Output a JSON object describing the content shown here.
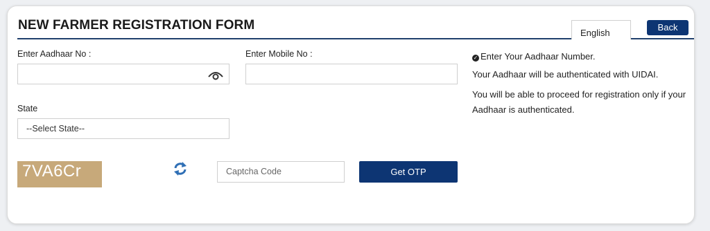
{
  "form": {
    "title": "NEW FARMER REGISTRATION FORM",
    "language": "English",
    "back_label": "Back",
    "aadhaar_label": "Enter Aadhaar No :",
    "aadhaar_value": "",
    "mobile_label": "Enter Mobile No :",
    "mobile_value": "",
    "state_label": "State",
    "state_selected": "--Select State--",
    "captcha_text": "7VA6Cr",
    "captcha_placeholder": "Captcha Code",
    "otp_label": "Get OTP"
  },
  "info": {
    "line1": "Enter Your Aadhaar Number.",
    "line2": "Your Aadhaar will be authenticated with UIDAI.",
    "line3": "You will be able to proceed for registration only if your Aadhaar is authenticated."
  },
  "colors": {
    "primary": "#0d3573",
    "captcha_bg": "#c7a97a"
  },
  "icons": {
    "eye": "eye-icon",
    "refresh": "refresh-icon",
    "check": "check-circle-icon"
  }
}
